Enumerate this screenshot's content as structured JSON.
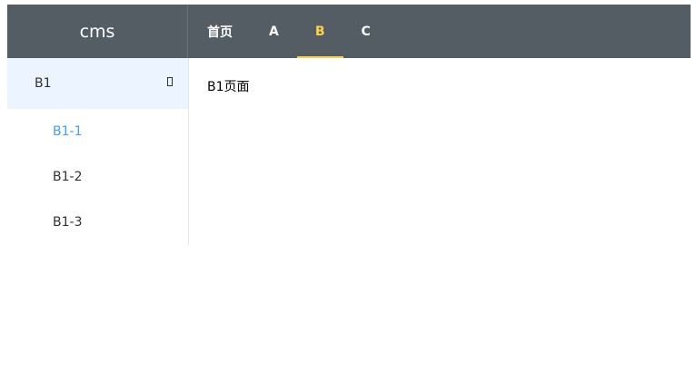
{
  "header": {
    "logo": "cms",
    "nav": [
      {
        "label": "首页",
        "active": false
      },
      {
        "label": "A",
        "active": false
      },
      {
        "label": "B",
        "active": true
      },
      {
        "label": "C",
        "active": false
      }
    ]
  },
  "sidebar": {
    "submenu_title": "B1",
    "items": [
      {
        "label": "B1-1",
        "active": true
      },
      {
        "label": "B1-2",
        "active": false
      },
      {
        "label": "B1-3",
        "active": false
      }
    ]
  },
  "main": {
    "content": "B1页面"
  },
  "colors": {
    "header_bg": "#545c64",
    "nav_active": "#ffd04b",
    "menu_active": "#409eff",
    "submenu_bg": "#ecf5ff"
  }
}
